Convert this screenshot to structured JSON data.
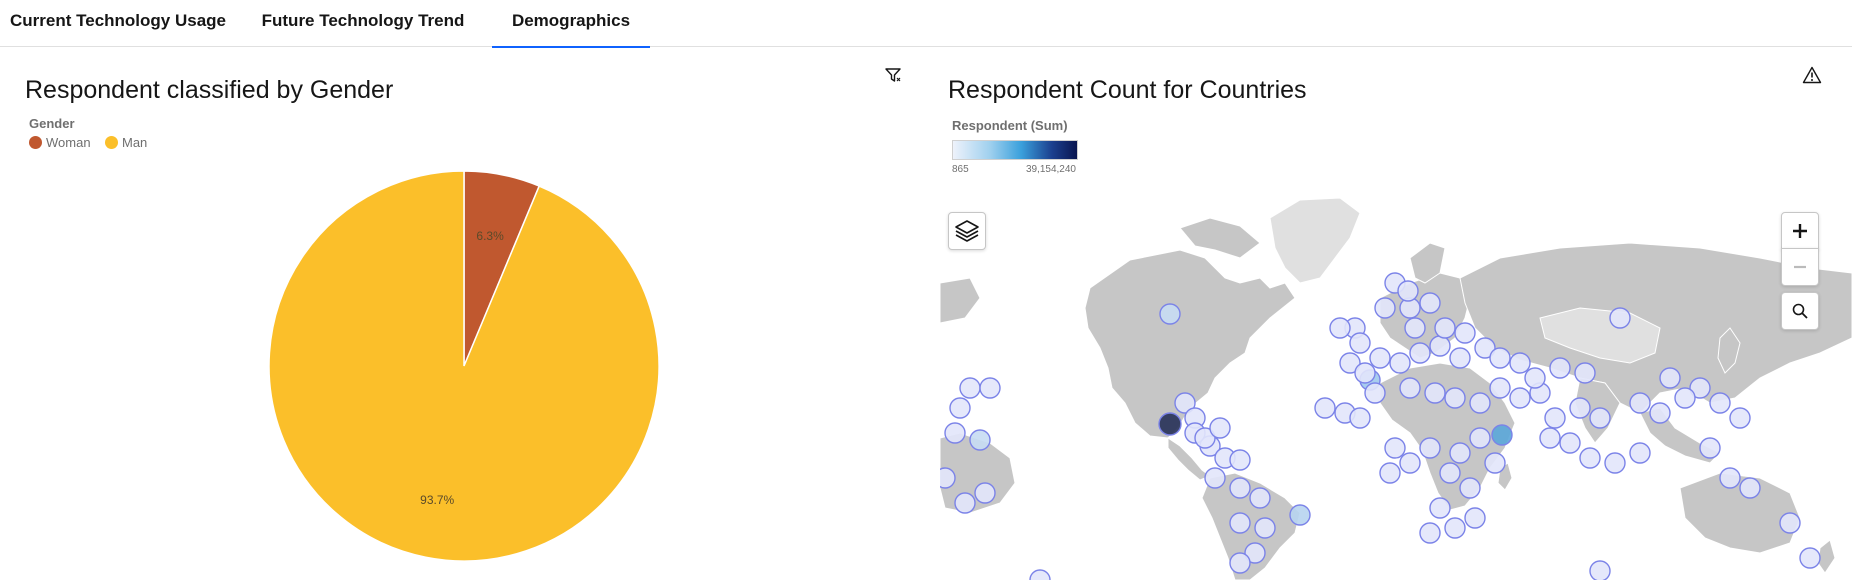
{
  "tabs": [
    {
      "label": "Current Technology Usage"
    },
    {
      "label": "Future Technology Trend"
    },
    {
      "label": "Demographics",
      "active": true
    }
  ],
  "gender_panel": {
    "title": "Respondent classified by Gender",
    "legend_title": "Gender",
    "legend": [
      {
        "label": "Woman",
        "color": "#c0582f"
      },
      {
        "label": "Man",
        "color": "#fbbf2a"
      }
    ],
    "filter_icon": "filter-icon"
  },
  "chart_data": {
    "type": "pie",
    "title": "Respondent classified by Gender",
    "legend_title": "Gender",
    "categories": [
      "Woman",
      "Man"
    ],
    "values": [
      6.3,
      93.7
    ],
    "labels": [
      "6.3%",
      "93.7%"
    ],
    "colors": [
      "#c0582f",
      "#fbbf2a"
    ]
  },
  "map_panel": {
    "title": "Respondent Count for Countries",
    "legend_title": "Respondent (Sum)",
    "scale_min": "865",
    "scale_max": "39,154,240",
    "scale_colors": [
      "#eef2fb",
      "#3aa0dc",
      "#0a1650"
    ],
    "warning_icon": "warning-icon",
    "layers_icon": "layers-icon",
    "zoom_in_icon": "plus-icon",
    "zoom_out_icon": "minus-icon",
    "search_icon": "search-icon"
  }
}
